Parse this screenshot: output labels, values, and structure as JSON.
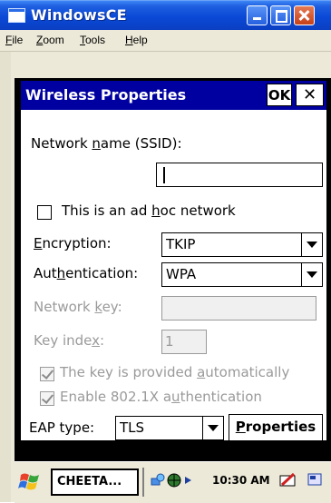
{
  "window": {
    "title": "WindowsCE",
    "menu": [
      "File",
      "Zoom",
      "Tools",
      "Help"
    ]
  },
  "dialog": {
    "title": "Wireless Properties",
    "ok_label": "OK",
    "close_label": "✕",
    "ssid_label": "Network name (SSID):",
    "ssid_value": "",
    "adhoc_label": "This is an ad hoc network",
    "adhoc_checked": false,
    "encryption_label": "Encryption:",
    "encryption_value": "TKIP",
    "authentication_label": "Authentication:",
    "authentication_value": "WPA",
    "network_key_label": "Network key:",
    "network_key_value": "",
    "key_index_label": "Key index:",
    "key_index_value": "1",
    "auto_key_label": "The key is provided automatically",
    "auto_key_checked": true,
    "enable_8021x_label": "Enable 802.1X authentication",
    "enable_8021x_checked": true,
    "eap_type_label": "EAP type:",
    "eap_type_value": "TLS",
    "properties_label": "Properties"
  },
  "taskbar": {
    "task_label": "CHEETA...",
    "time": "10:30 AM"
  },
  "colors": {
    "dialog_title_bg": "#0000a0",
    "host_title_bg": "#0a49d6",
    "disabled_text": "#9a9a9a"
  }
}
